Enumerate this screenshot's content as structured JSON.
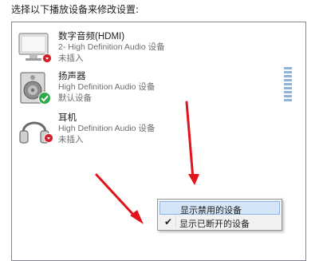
{
  "header": {
    "text": "选择以下播放设备来修改设置:"
  },
  "devices": [
    {
      "name": "数字音频(HDMI)",
      "description": "2- High Definition Audio 设备",
      "status": "未插入",
      "icon": "hdmi-monitor-icon",
      "badge": "unplugged-badge"
    },
    {
      "name": "扬声器",
      "description": "High Definition Audio 设备",
      "status": "默认设备",
      "icon": "speaker-icon",
      "badge": "default-check-badge"
    },
    {
      "name": "耳机",
      "description": "High Definition Audio 设备",
      "status": "未插入",
      "icon": "headphones-icon",
      "badge": "unplugged-badge"
    }
  ],
  "context_menu": {
    "items": [
      {
        "label": "显示禁用的设备",
        "checked": false
      },
      {
        "label": "显示已断开的设备",
        "checked": true
      }
    ]
  },
  "colors": {
    "arrow": "#e0141a",
    "check_badge": "#2ea84a",
    "unplugged_badge": "#d0202a",
    "highlight": "#d5e5f8",
    "meter": "#8fb3d8"
  },
  "annotations": [
    "red-arrow-icon",
    "red-arrow-icon"
  ]
}
